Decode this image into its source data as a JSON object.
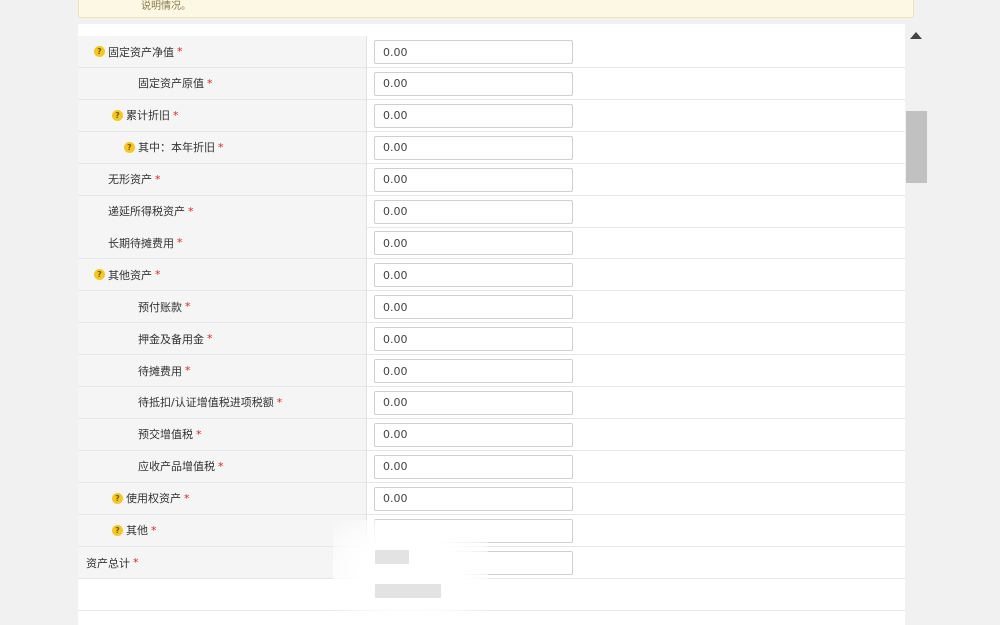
{
  "notice": {
    "text": "说明情况。"
  },
  "rows": [
    {
      "label": "固定资产净值",
      "value": "0.00",
      "help": true,
      "indent": 1
    },
    {
      "label": "固定资产原值",
      "value": "0.00",
      "help": false,
      "indent": 3
    },
    {
      "label": "累计折旧",
      "value": "0.00",
      "help": true,
      "indent": 2
    },
    {
      "label": "其中：本年折旧",
      "value": "0.00",
      "help": true,
      "indent": 3
    },
    {
      "label": "无形资产",
      "value": "0.00",
      "help": false,
      "indent": 1
    },
    {
      "label": "递延所得税资产",
      "value": "0.00",
      "help": false,
      "indent": 1
    },
    {
      "label": "长期待摊费用",
      "value": "0.00",
      "help": false,
      "indent": 1
    },
    {
      "label": "其他资产",
      "value": "0.00",
      "help": true,
      "indent": 1
    },
    {
      "label": "预付账款",
      "value": "0.00",
      "help": false,
      "indent": 3
    },
    {
      "label": "押金及备用金",
      "value": "0.00",
      "help": false,
      "indent": 3
    },
    {
      "label": "待摊费用",
      "value": "0.00",
      "help": false,
      "indent": 3
    },
    {
      "label": "待抵扣/认证增值税进项税额",
      "value": "0.00",
      "help": false,
      "indent": 3
    },
    {
      "label": "预交增值税",
      "value": "0.00",
      "help": false,
      "indent": 3
    },
    {
      "label": "应收产品增值税",
      "value": "0.00",
      "help": false,
      "indent": 3
    },
    {
      "label": "使用权资产",
      "value": "0.00",
      "help": true,
      "indent": 2
    },
    {
      "label": "其他",
      "value": "",
      "help": true,
      "indent": 2
    },
    {
      "label": "资产总计",
      "value": "",
      "help": false,
      "indent": 0
    }
  ],
  "required_mark": "*",
  "help_glyph": "?",
  "colors": {
    "required": "#e02020",
    "help_icon": "#f6c623",
    "label_bg": "#f5f5f5"
  }
}
